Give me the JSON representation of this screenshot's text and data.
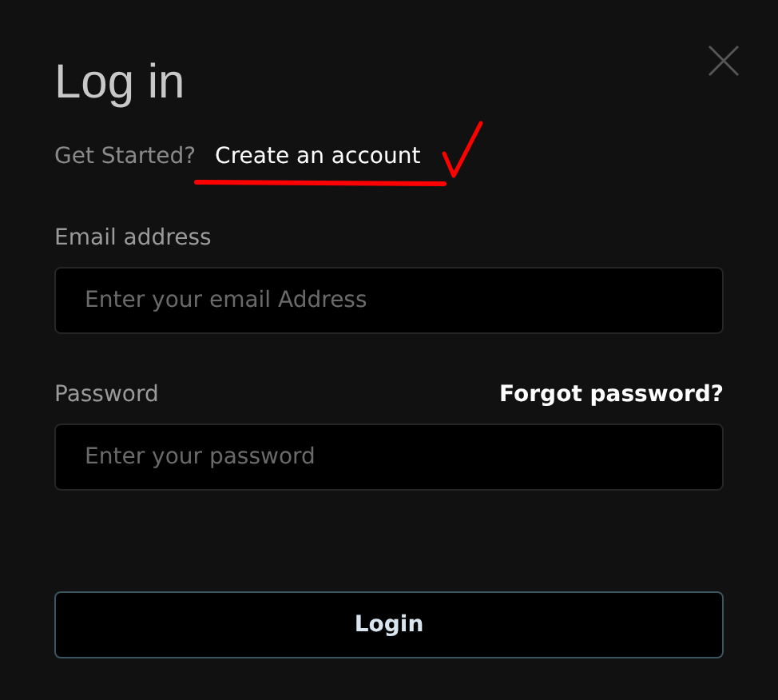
{
  "dialog": {
    "title": "Log in",
    "prompt": "Get Started?",
    "create_account_link": "Create an account",
    "annotation": {
      "underline": true,
      "check": true
    },
    "fields": [
      {
        "label": "Email address",
        "placeholder": "Enter your email Address"
      },
      {
        "label": "Password",
        "placeholder": "Enter your password",
        "link": "Forgot password?"
      }
    ],
    "submit": "Login"
  }
}
